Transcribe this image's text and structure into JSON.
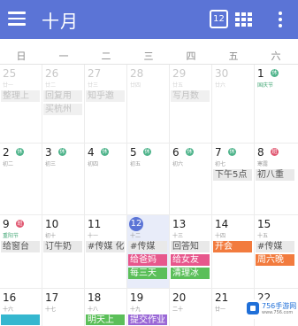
{
  "app_bar": {
    "title": "十月",
    "today_button_label": "12",
    "colors": {
      "background": "#5b74d6",
      "text": "#ffffff"
    },
    "icons": [
      "hamburger-menu-icon",
      "calendar-today-icon",
      "grid-view-icon",
      "more-vert-icon"
    ]
  },
  "weekdays": [
    "日",
    "一",
    "二",
    "三",
    "四",
    "五",
    "六"
  ],
  "weeks": [
    {
      "days": [
        {
          "day": "25",
          "lunar": "廿一",
          "dim": true,
          "events": [
            {
              "text": "整理上",
              "style": "greyfaint"
            }
          ]
        },
        {
          "day": "26",
          "lunar": "廿二",
          "dim": true,
          "events": [
            {
              "text": "回复用",
              "style": "greyfaint"
            },
            {
              "text": "买杭州",
              "style": "greyfaint"
            }
          ]
        },
        {
          "day": "27",
          "lunar": "廿三",
          "dim": true,
          "events": [
            {
              "text": "知乎邀",
              "style": "greyfaint"
            }
          ]
        },
        {
          "day": "28",
          "lunar": "廿四",
          "dim": true,
          "events": []
        },
        {
          "day": "29",
          "lunar": "廿五",
          "dim": true,
          "events": [
            {
              "text": "写月数",
              "style": "greyfaint"
            }
          ]
        },
        {
          "day": "30",
          "lunar": "廿六",
          "dim": true,
          "events": []
        },
        {
          "day": "1",
          "lunar": "国庆节",
          "lunar_holiday": true,
          "badge": {
            "text": "休",
            "color": "green"
          },
          "events": []
        }
      ]
    },
    {
      "days": [
        {
          "day": "2",
          "lunar": "初二",
          "badge": {
            "text": "休",
            "color": "green"
          },
          "events": []
        },
        {
          "day": "3",
          "lunar": "初三",
          "badge": {
            "text": "休",
            "color": "green"
          },
          "events": []
        },
        {
          "day": "4",
          "lunar": "初四",
          "badge": {
            "text": "休",
            "color": "green"
          },
          "events": []
        },
        {
          "day": "5",
          "lunar": "初五",
          "badge": {
            "text": "休",
            "color": "green"
          },
          "events": []
        },
        {
          "day": "6",
          "lunar": "初六",
          "badge": {
            "text": "休",
            "color": "green"
          },
          "events": []
        },
        {
          "day": "7",
          "lunar": "初七",
          "badge": {
            "text": "休",
            "color": "green"
          },
          "events": [
            {
              "text": "下午5点",
              "style": "grey"
            }
          ]
        },
        {
          "day": "8",
          "lunar": "寒露",
          "badge": {
            "text": "班",
            "color": "red"
          },
          "events": [
            {
              "text": "初八重",
              "style": "grey"
            }
          ]
        }
      ]
    },
    {
      "days": [
        {
          "day": "9",
          "lunar": "重阳节",
          "lunar_holiday": true,
          "badge": {
            "text": "班",
            "color": "red"
          },
          "events": [
            {
              "text": "给窗台",
              "style": "grey"
            }
          ]
        },
        {
          "day": "10",
          "lunar": "初十",
          "events": [
            {
              "text": "订牛奶",
              "style": "grey"
            }
          ]
        },
        {
          "day": "11",
          "lunar": "十一",
          "events": [
            {
              "text": "#传媒 化",
              "style": "grey"
            }
          ]
        },
        {
          "day": "12",
          "lunar": "十二",
          "today": true,
          "events": [
            {
              "text": "#传媒",
              "style": "grey"
            },
            {
              "text": "给爸妈",
              "style": "pink"
            },
            {
              "text": "每三天",
              "style": "green"
            }
          ]
        },
        {
          "day": "13",
          "lunar": "十三",
          "events": [
            {
              "text": "回答知",
              "style": "grey"
            },
            {
              "text": "给女友",
              "style": "pink"
            },
            {
              "text": "清理冰",
              "style": "green"
            }
          ]
        },
        {
          "day": "14",
          "lunar": "十四",
          "events": [
            {
              "text": "开会",
              "style": "orange"
            }
          ]
        },
        {
          "day": "15",
          "lunar": "十五",
          "events": [
            {
              "text": "#传媒",
              "style": "grey"
            },
            {
              "text": "周六晚",
              "style": "orange"
            }
          ]
        }
      ]
    },
    {
      "days": [
        {
          "day": "16",
          "lunar": "十六",
          "events": [
            {
              "text": "",
              "style": "teal"
            }
          ]
        },
        {
          "day": "17",
          "lunar": "十七",
          "events": []
        },
        {
          "day": "18",
          "lunar": "十八",
          "events": [
            {
              "text": "明天上",
              "style": "green"
            }
          ]
        },
        {
          "day": "19",
          "lunar": "十九",
          "events": [
            {
              "text": "提交作业",
              "style": "purple"
            }
          ]
        },
        {
          "day": "20",
          "lunar": "二十",
          "events": []
        },
        {
          "day": "21",
          "lunar": "廿一",
          "events": []
        },
        {
          "day": "22",
          "lunar": "廿二",
          "events": []
        }
      ]
    }
  ],
  "watermark": {
    "text": "756手游网",
    "sub": "www.756.com"
  }
}
